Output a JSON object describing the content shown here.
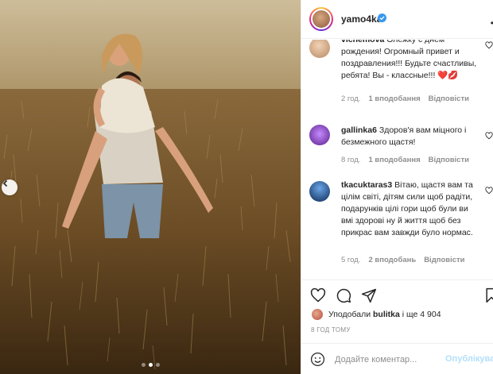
{
  "post": {
    "photo_alt": "",
    "carousel": {
      "total": 3,
      "active": 1
    }
  },
  "header": {
    "username": "yamo4ka",
    "verified": true,
    "more_icon": "more-dots-icon"
  },
  "comments": [
    {
      "username": "vichemova",
      "text": "Олежку с днем рождения! Огромный привет и поздравления!!! Будьте счастливы, ребята! Вы - классные!!! ❤️💋",
      "time": "2 год.",
      "likes": "1 вподобання",
      "reply": "Відповісти"
    },
    {
      "username": "gallinka6",
      "text": "Здоров'я вам міцного і безмежного щастя!",
      "time": "8 год.",
      "likes": "1 вподобання",
      "reply": "Відповісти"
    },
    {
      "username": "tkacuktaras3",
      "text": "Вітаю, щастя вам та цілім світі, дітям сили щоб радіти, подарунків цілі гори щоб були ви вмі здорові ну й життя щоб без прикрас вам завжди було нормас.",
      "time": "5 год.",
      "likes": "2 вподобань",
      "reply": "Відповісти"
    }
  ],
  "likes": {
    "prefix": "Уподобали",
    "user": "bulitka",
    "suffix": "і ще 4 904"
  },
  "time_ago": "8 ГОД ТОМУ",
  "add_comment": {
    "placeholder": "Додайте коментар...",
    "publish": "Опублікува"
  },
  "colors": {
    "accent_blue": "#0095f6",
    "publish_disabled": "#b2dffc",
    "verified": "#3897f0",
    "meta_gray": "#8e8e8e"
  }
}
